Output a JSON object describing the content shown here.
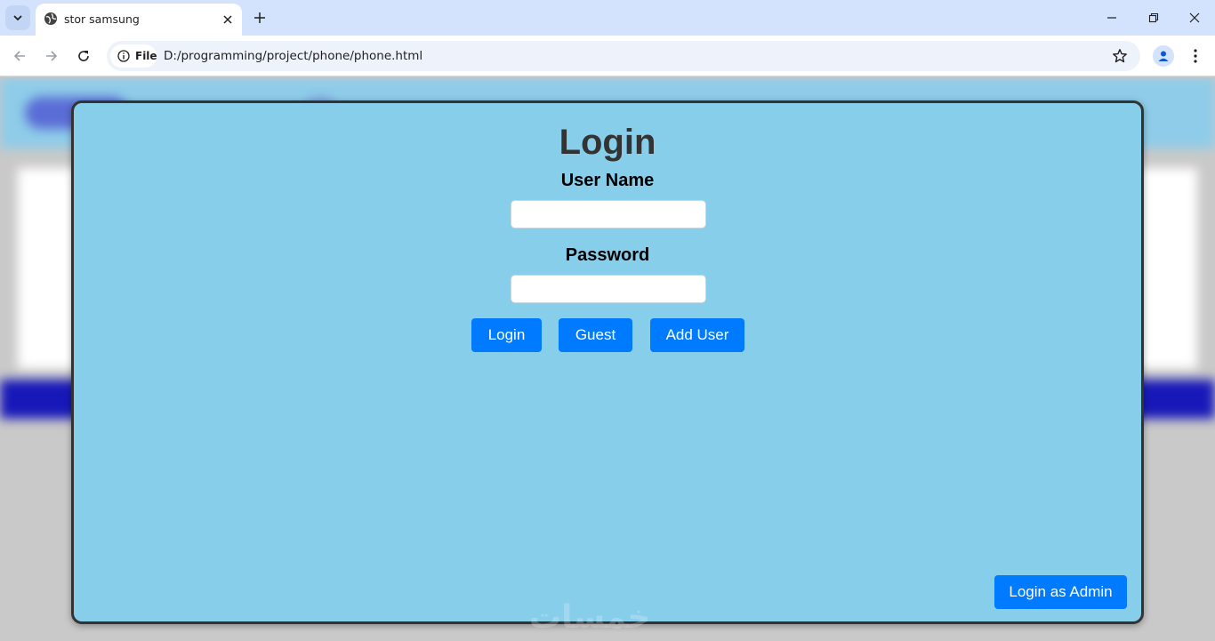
{
  "browser": {
    "tab_title": "stor samsung",
    "site_chip_label": "File",
    "url": "D:/programming/project/phone/phone.html"
  },
  "icons": {
    "tab_search": "chevron-down-icon",
    "favicon": "globe-icon",
    "tab_close": "close-icon",
    "new_tab": "plus-icon",
    "minimize": "minimize-icon",
    "restore": "restore-icon",
    "close_window": "close-icon",
    "back": "arrow-left-icon",
    "forward": "arrow-right-icon",
    "reload": "reload-icon",
    "info": "info-icon",
    "bookmark": "star-icon",
    "profile": "person-icon",
    "menu": "more-vertical-icon"
  },
  "login": {
    "title": "Login",
    "username_label": "User Name",
    "username_value": "",
    "password_label": "Password",
    "password_value": "",
    "buttons": {
      "login": "Login",
      "guest": "Guest",
      "add_user": "Add User",
      "admin": "Login as Admin"
    }
  },
  "watermark": "خمسات",
  "colors": {
    "modal_bg": "#87ceeb",
    "modal_border": "#333333",
    "button_primary": "#007bff",
    "tabstrip": "#d3e3fd"
  }
}
